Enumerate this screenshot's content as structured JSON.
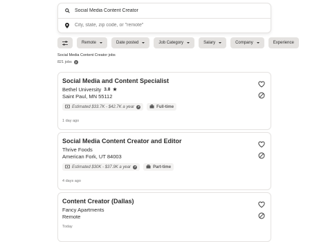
{
  "search": {
    "what_value": "Social Media Content Creator",
    "where_placeholder": "City, state, zip code, or \"remote\""
  },
  "filters": [
    {
      "label": "Remote"
    },
    {
      "label": "Date posted"
    },
    {
      "label": "Job Category"
    },
    {
      "label": "Salary"
    },
    {
      "label": "Company"
    },
    {
      "label": "Experience"
    }
  ],
  "results": {
    "title": "Social Media Content Creator jobs",
    "count": "821 jobs"
  },
  "jobs": [
    {
      "title": "Social Media and Content Specialist",
      "company": "Bethel University",
      "rating": "3.8",
      "location": "Saint Paul, MN 55112",
      "salary": "Estimated $33.7K - $42.7K a year",
      "job_type": "Full-time",
      "posted": "1 day ago"
    },
    {
      "title": "Social Media Content Creator and Editor",
      "company": "Thrive Foods",
      "rating": "",
      "location": "American Fork, UT 84003",
      "salary": "Estimated $30K - $37.9K a year",
      "job_type": "Part-time",
      "posted": "4 days ago"
    },
    {
      "title": "Content Creator (Dallas)",
      "company": "Fancy Apartments",
      "rating": "",
      "location": "Remote",
      "salary": "",
      "job_type": "",
      "posted": "Today"
    }
  ],
  "icons": {
    "search": "search-icon",
    "location": "location-pin-icon",
    "filter": "sliders-icon",
    "rating": "star-icon",
    "salary": "money-icon",
    "job_type": "briefcase-icon",
    "save": "heart-icon",
    "hide": "not-interested-icon"
  }
}
